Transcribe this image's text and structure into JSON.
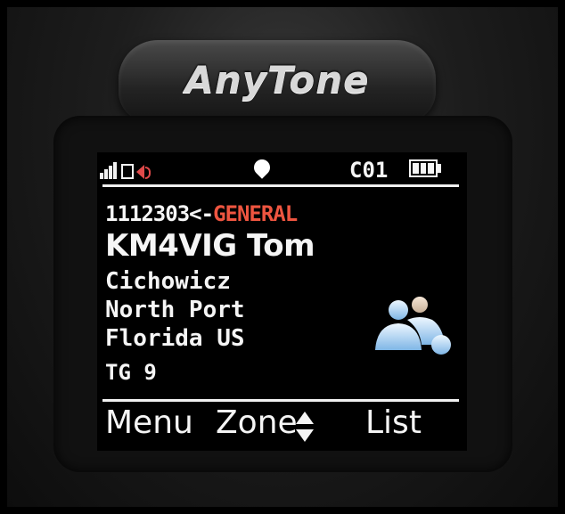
{
  "device": {
    "brand": "AnyTone"
  },
  "status_bar": {
    "signal_icon": "signal-strength-icon",
    "sd_icon": "sd-card-icon",
    "speaker_icon": "speaker-icon",
    "gps_icon": "gps-pin-icon",
    "channel": "C01",
    "battery_icon": "battery-icon",
    "speaker_color": "#e04a4a"
  },
  "call_info": {
    "radio_id": "1112303",
    "separator": "<-",
    "talkgroup_name": "GENERAL",
    "callsign_name": "KM4VIG Tom",
    "surname": "Cichowicz",
    "city": "North Port",
    "region": "Florida US",
    "talkgroup": "TG 9",
    "contact_icon": "group-contact-icon",
    "accent_color": "#ee5540"
  },
  "softkeys": {
    "menu": "Menu",
    "zone": "Zone",
    "zone_icon": "up-down-arrows-icon",
    "list": "List"
  }
}
